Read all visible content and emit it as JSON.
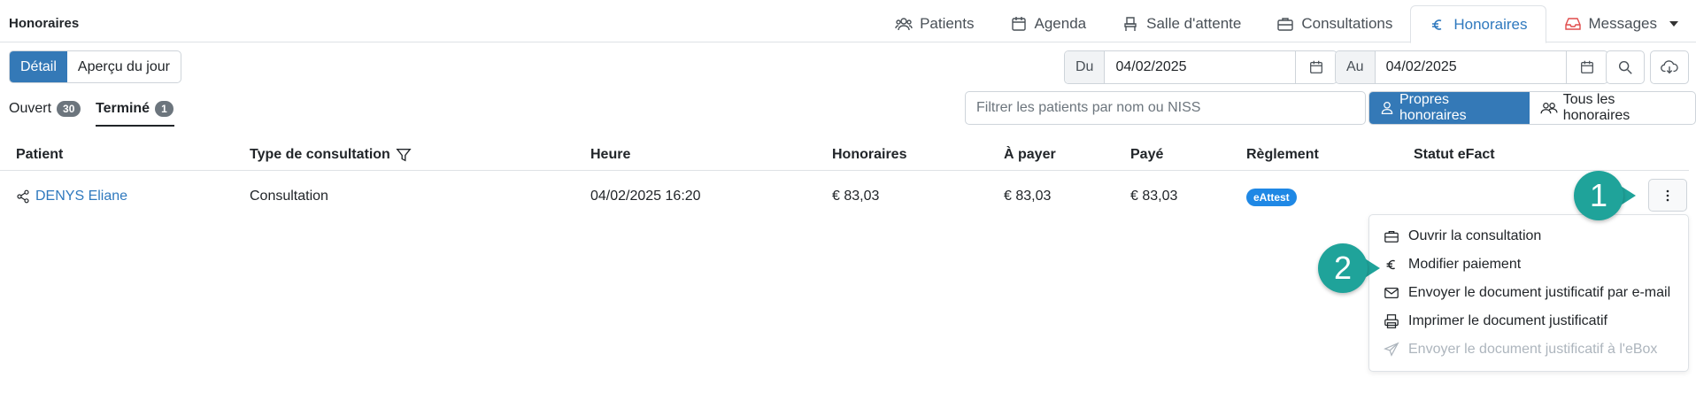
{
  "app": {
    "title": "Honoraires"
  },
  "nav": {
    "items": [
      {
        "label": "Patients",
        "icon": "users-icon"
      },
      {
        "label": "Agenda",
        "icon": "calendar-icon"
      },
      {
        "label": "Salle d'attente",
        "icon": "chair-icon"
      },
      {
        "label": "Consultations",
        "icon": "briefcase-icon"
      },
      {
        "label": "Honoraires",
        "icon": "euro-icon",
        "active": true
      },
      {
        "label": "Messages",
        "icon": "inbox-icon"
      }
    ]
  },
  "view_toggle": {
    "detail": "Détail",
    "overview": "Aperçu du jour",
    "selected": "Détail"
  },
  "date_range": {
    "from_label": "Du",
    "from_value": "04/02/2025",
    "to_label": "Au",
    "to_value": "04/02/2025"
  },
  "status_tabs": [
    {
      "label": "Ouvert",
      "count": "30"
    },
    {
      "label": "Terminé",
      "count": "1",
      "active": true
    }
  ],
  "search": {
    "placeholder": "Filtrer les patients par nom ou NISS"
  },
  "scope": {
    "own": "Propres honoraires",
    "all": "Tous les honoraires",
    "selected": "Propres honoraires"
  },
  "table": {
    "headers": {
      "patient": "Patient",
      "type": "Type de consultation",
      "time": "Heure",
      "fees": "Honoraires",
      "to_pay": "À payer",
      "paid": "Payé",
      "settlement": "Règlement",
      "efact": "Statut eFact"
    },
    "rows": [
      {
        "patient": "DENYS Eliane",
        "type": "Consultation",
        "time": "04/02/2025 16:20",
        "fees": "€ 83,03",
        "to_pay": "€ 83,03",
        "paid": "€ 83,03",
        "settlement": "eAttest",
        "efact": ""
      }
    ]
  },
  "row_menu": {
    "items": [
      {
        "label": "Ouvrir la consultation",
        "icon": "briefcase-icon"
      },
      {
        "label": "Modifier paiement",
        "icon": "euro-icon"
      },
      {
        "label": "Envoyer le document justificatif par e-mail",
        "icon": "envelope-icon"
      },
      {
        "label": "Imprimer le document justificatif",
        "icon": "printer-icon"
      },
      {
        "label": "Envoyer le document justificatif à l'eBox",
        "icon": "send-icon",
        "disabled": true
      }
    ]
  },
  "callouts": [
    "1",
    "2"
  ],
  "colors": {
    "primary": "#3479b7",
    "link": "#2f79be",
    "callout": "#1fa39a",
    "pill": "#1f88e5"
  }
}
